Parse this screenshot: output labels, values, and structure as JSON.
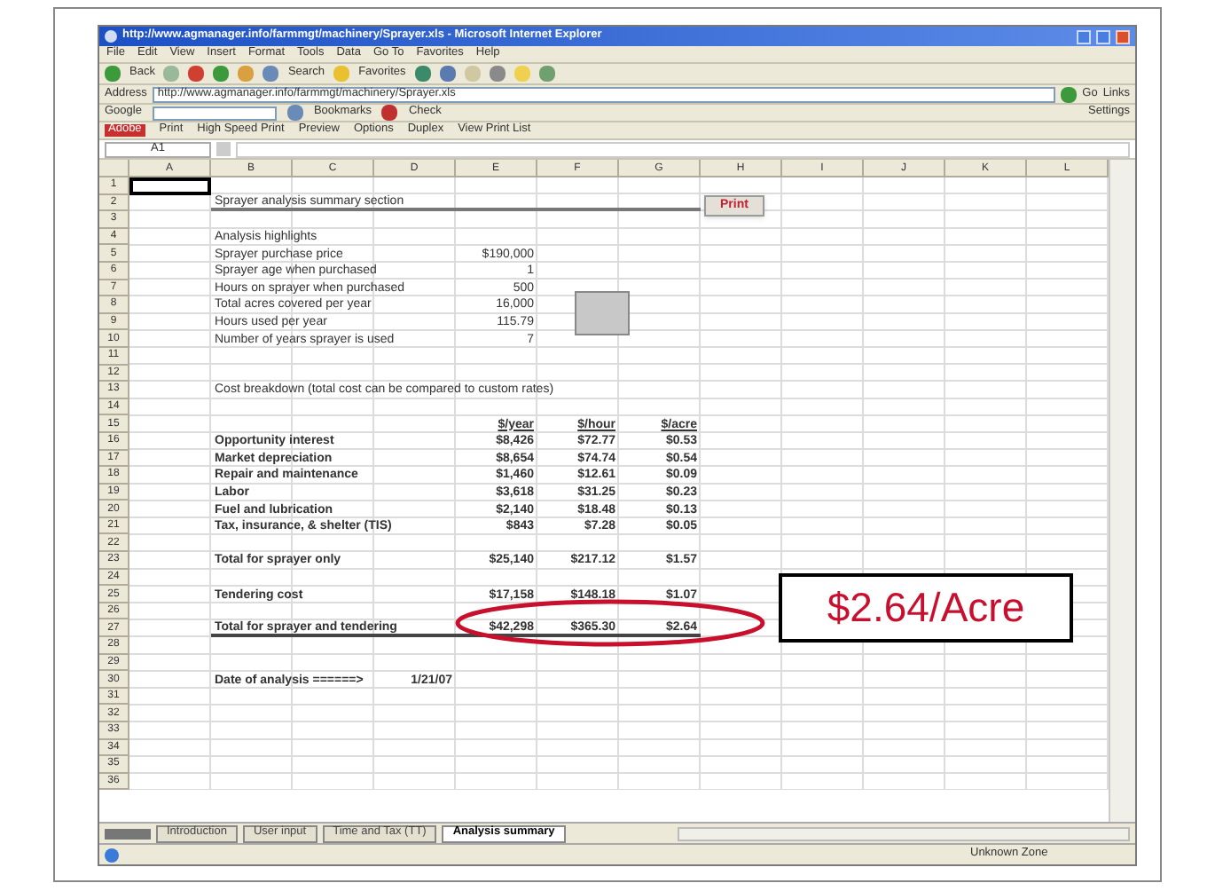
{
  "window": {
    "title": "http://www.agmanager.info/farmmgt/machinery/Sprayer.xls - Microsoft Internet Explorer"
  },
  "menu": [
    "File",
    "Edit",
    "View",
    "Insert",
    "Format",
    "Tools",
    "Data",
    "Go To",
    "Favorites",
    "Help"
  ],
  "toolbar": [
    "Back",
    "Search",
    "Favorites"
  ],
  "address": {
    "label": "Address",
    "url": "http://www.agmanager.info/farmmgt/machinery/Sprayer.xls",
    "go": "Go",
    "links": "Links"
  },
  "google_bar": [
    "Google",
    "Bookmarks",
    "Check",
    "Settings"
  ],
  "print_bar": [
    "Adobe",
    "Print",
    "High Speed Print",
    "Preview",
    "Options",
    "Duplex",
    "View Print List"
  ],
  "name_box": "A1",
  "sheet": {
    "columns": [
      "A",
      "B",
      "C",
      "D",
      "E",
      "F",
      "G",
      "H",
      "I",
      "J",
      "K",
      "L"
    ],
    "rows": [
      {
        "number": "1",
        "kind": "active",
        "cells": []
      },
      {
        "number": "2",
        "kind": "title",
        "cells": [
          "",
          "Sprayer analysis summary section",
          "",
          "",
          "",
          "",
          "",
          "Print"
        ]
      },
      {
        "number": "3",
        "kind": "blank",
        "cells": []
      },
      {
        "number": "4",
        "kind": "plain",
        "cells": [
          "",
          "Analysis highlights"
        ]
      },
      {
        "number": "5",
        "kind": "plain",
        "cells": [
          "",
          "Sprayer purchase price",
          "",
          "",
          "$190,000"
        ]
      },
      {
        "number": "6",
        "kind": "plain",
        "cells": [
          "",
          "Sprayer age when purchased",
          "",
          "",
          "1"
        ]
      },
      {
        "number": "7",
        "kind": "plain",
        "cells": [
          "",
          "Hours on sprayer when purchased",
          "",
          "",
          "500"
        ]
      },
      {
        "number": "8",
        "kind": "plain",
        "cells": [
          "",
          "Total acres covered per year",
          "",
          "",
          "16,000"
        ]
      },
      {
        "number": "9",
        "kind": "plain",
        "cells": [
          "",
          "Hours used per year",
          "",
          "",
          "115.79"
        ]
      },
      {
        "number": "10",
        "kind": "plain",
        "cells": [
          "",
          "Number of years sprayer is used",
          "",
          "",
          "7"
        ]
      },
      {
        "number": "11",
        "kind": "blank",
        "cells": []
      },
      {
        "number": "12",
        "kind": "blank",
        "cells": []
      },
      {
        "number": "13",
        "kind": "plain",
        "cells": [
          "",
          "Cost breakdown (total cost can be compared to custom rates)"
        ]
      },
      {
        "number": "14",
        "kind": "blank",
        "cells": []
      },
      {
        "number": "15",
        "kind": "heading",
        "cells": [
          "",
          "",
          "",
          "",
          "$/year",
          "$/hour",
          "$/acre"
        ]
      },
      {
        "number": "16",
        "kind": "bold",
        "cells": [
          "",
          "Opportunity interest",
          "",
          "",
          "$8,426",
          "$72.77",
          "$0.53"
        ]
      },
      {
        "number": "17",
        "kind": "bold",
        "cells": [
          "",
          "Market depreciation",
          "",
          "",
          "$8,654",
          "$74.74",
          "$0.54"
        ]
      },
      {
        "number": "18",
        "kind": "bold",
        "cells": [
          "",
          "Repair and maintenance",
          "",
          "",
          "$1,460",
          "$12.61",
          "$0.09"
        ]
      },
      {
        "number": "19",
        "kind": "bold",
        "cells": [
          "",
          "Labor",
          "",
          "",
          "$3,618",
          "$31.25",
          "$0.23"
        ]
      },
      {
        "number": "20",
        "kind": "bold",
        "cells": [
          "",
          "Fuel and lubrication",
          "",
          "",
          "$2,140",
          "$18.48",
          "$0.13"
        ]
      },
      {
        "number": "21",
        "kind": "bold",
        "cells": [
          "",
          "Tax, insurance, & shelter (TIS)",
          "",
          "",
          "$843",
          "$7.28",
          "$0.05"
        ]
      },
      {
        "number": "22",
        "kind": "blank",
        "cells": []
      },
      {
        "number": "23",
        "kind": "bold",
        "cells": [
          "",
          "Total for sprayer only",
          "",
          "",
          "$25,140",
          "$217.12",
          "$1.57"
        ]
      },
      {
        "number": "24",
        "kind": "blank",
        "cells": []
      },
      {
        "number": "25",
        "kind": "bold",
        "cells": [
          "",
          "Tendering cost",
          "",
          "",
          "$17,158",
          "$148.18",
          "$1.07"
        ]
      },
      {
        "number": "26",
        "kind": "blank",
        "cells": []
      },
      {
        "number": "27",
        "kind": "total",
        "cells": [
          "",
          "Total for sprayer and tendering",
          "",
          "",
          "$42,298",
          "$365.30",
          "$2.64"
        ]
      },
      {
        "number": "28",
        "kind": "blank",
        "cells": []
      },
      {
        "number": "29",
        "kind": "blank",
        "cells": []
      },
      {
        "number": "30",
        "kind": "bold",
        "cells": [
          "",
          "Date of analysis ======>",
          "",
          "1/21/07"
        ]
      },
      {
        "number": "31",
        "kind": "blank",
        "cells": []
      },
      {
        "number": "32",
        "kind": "blank",
        "cells": []
      },
      {
        "number": "33",
        "kind": "blank",
        "cells": []
      },
      {
        "number": "34",
        "kind": "blank",
        "cells": []
      },
      {
        "number": "35",
        "kind": "blank",
        "cells": []
      },
      {
        "number": "36",
        "kind": "blank",
        "cells": []
      }
    ]
  },
  "sheet_tabs": [
    {
      "label": "Introduction",
      "selected": false
    },
    {
      "label": "User input",
      "selected": false
    },
    {
      "label": "Time and Tax (TT)",
      "selected": false
    },
    {
      "label": "Analysis summary",
      "selected": true
    }
  ],
  "status_bar": {
    "zone": "Unknown Zone"
  },
  "callout": {
    "text": "$2.64/Acre"
  }
}
